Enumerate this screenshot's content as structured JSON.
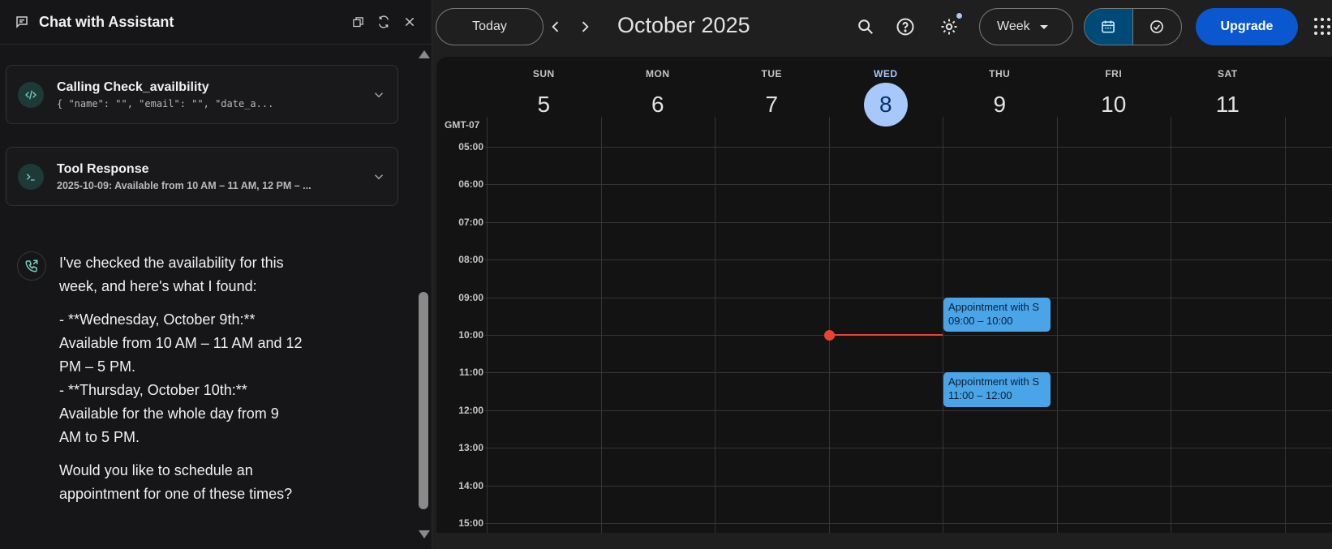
{
  "chat": {
    "title": "Chat with Assistant",
    "header_icons": [
      "restore-window-icon",
      "refresh-icon",
      "close-icon"
    ],
    "tool_call": {
      "name": "Calling Check_availbility",
      "args": "{ \"name\": \"\", \"email\": \"\", \"date_a..."
    },
    "tool_response": {
      "name": "Tool Response",
      "summary": "2025-10-09: Available from 10 AM – 11 AM, 12 PM – ..."
    },
    "message": {
      "p1": "I've checked the availability for this week, and here's what I found:",
      "p2_l1": "- **Wednesday, October 9th:** Available from 10 AM – 11 AM and 12 PM – 5 PM.",
      "p2_l2": "- **Thursday, October 10th:** Available for the whole day from 9 AM to 5 PM.",
      "p3": "Would you like to schedule an appointment for one of these times?"
    }
  },
  "calendar": {
    "today_label": "Today",
    "month_title": "October 2025",
    "view_label": "Week",
    "upgrade_label": "Upgrade",
    "timezone": "GMT-07",
    "colors": {
      "today_accent": "#a8c7fa",
      "event": "#4aa5e8",
      "now": "#ea4335",
      "upgrade": "#0b57d0"
    },
    "days": [
      {
        "name": "SUN",
        "num": "5"
      },
      {
        "name": "MON",
        "num": "6"
      },
      {
        "name": "TUE",
        "num": "7"
      },
      {
        "name": "WED",
        "num": "8",
        "today": true
      },
      {
        "name": "THU",
        "num": "9"
      },
      {
        "name": "FRI",
        "num": "10"
      },
      {
        "name": "SAT",
        "num": "11"
      }
    ],
    "hours": [
      "05:00",
      "06:00",
      "07:00",
      "08:00",
      "09:00",
      "10:00",
      "11:00",
      "12:00",
      "13:00",
      "14:00",
      "15:00"
    ],
    "events": [
      {
        "title": "Appointment with S",
        "time": "09:00 – 10:00"
      },
      {
        "title": "Appointment with S",
        "time": "11:00 – 12:00"
      }
    ]
  }
}
